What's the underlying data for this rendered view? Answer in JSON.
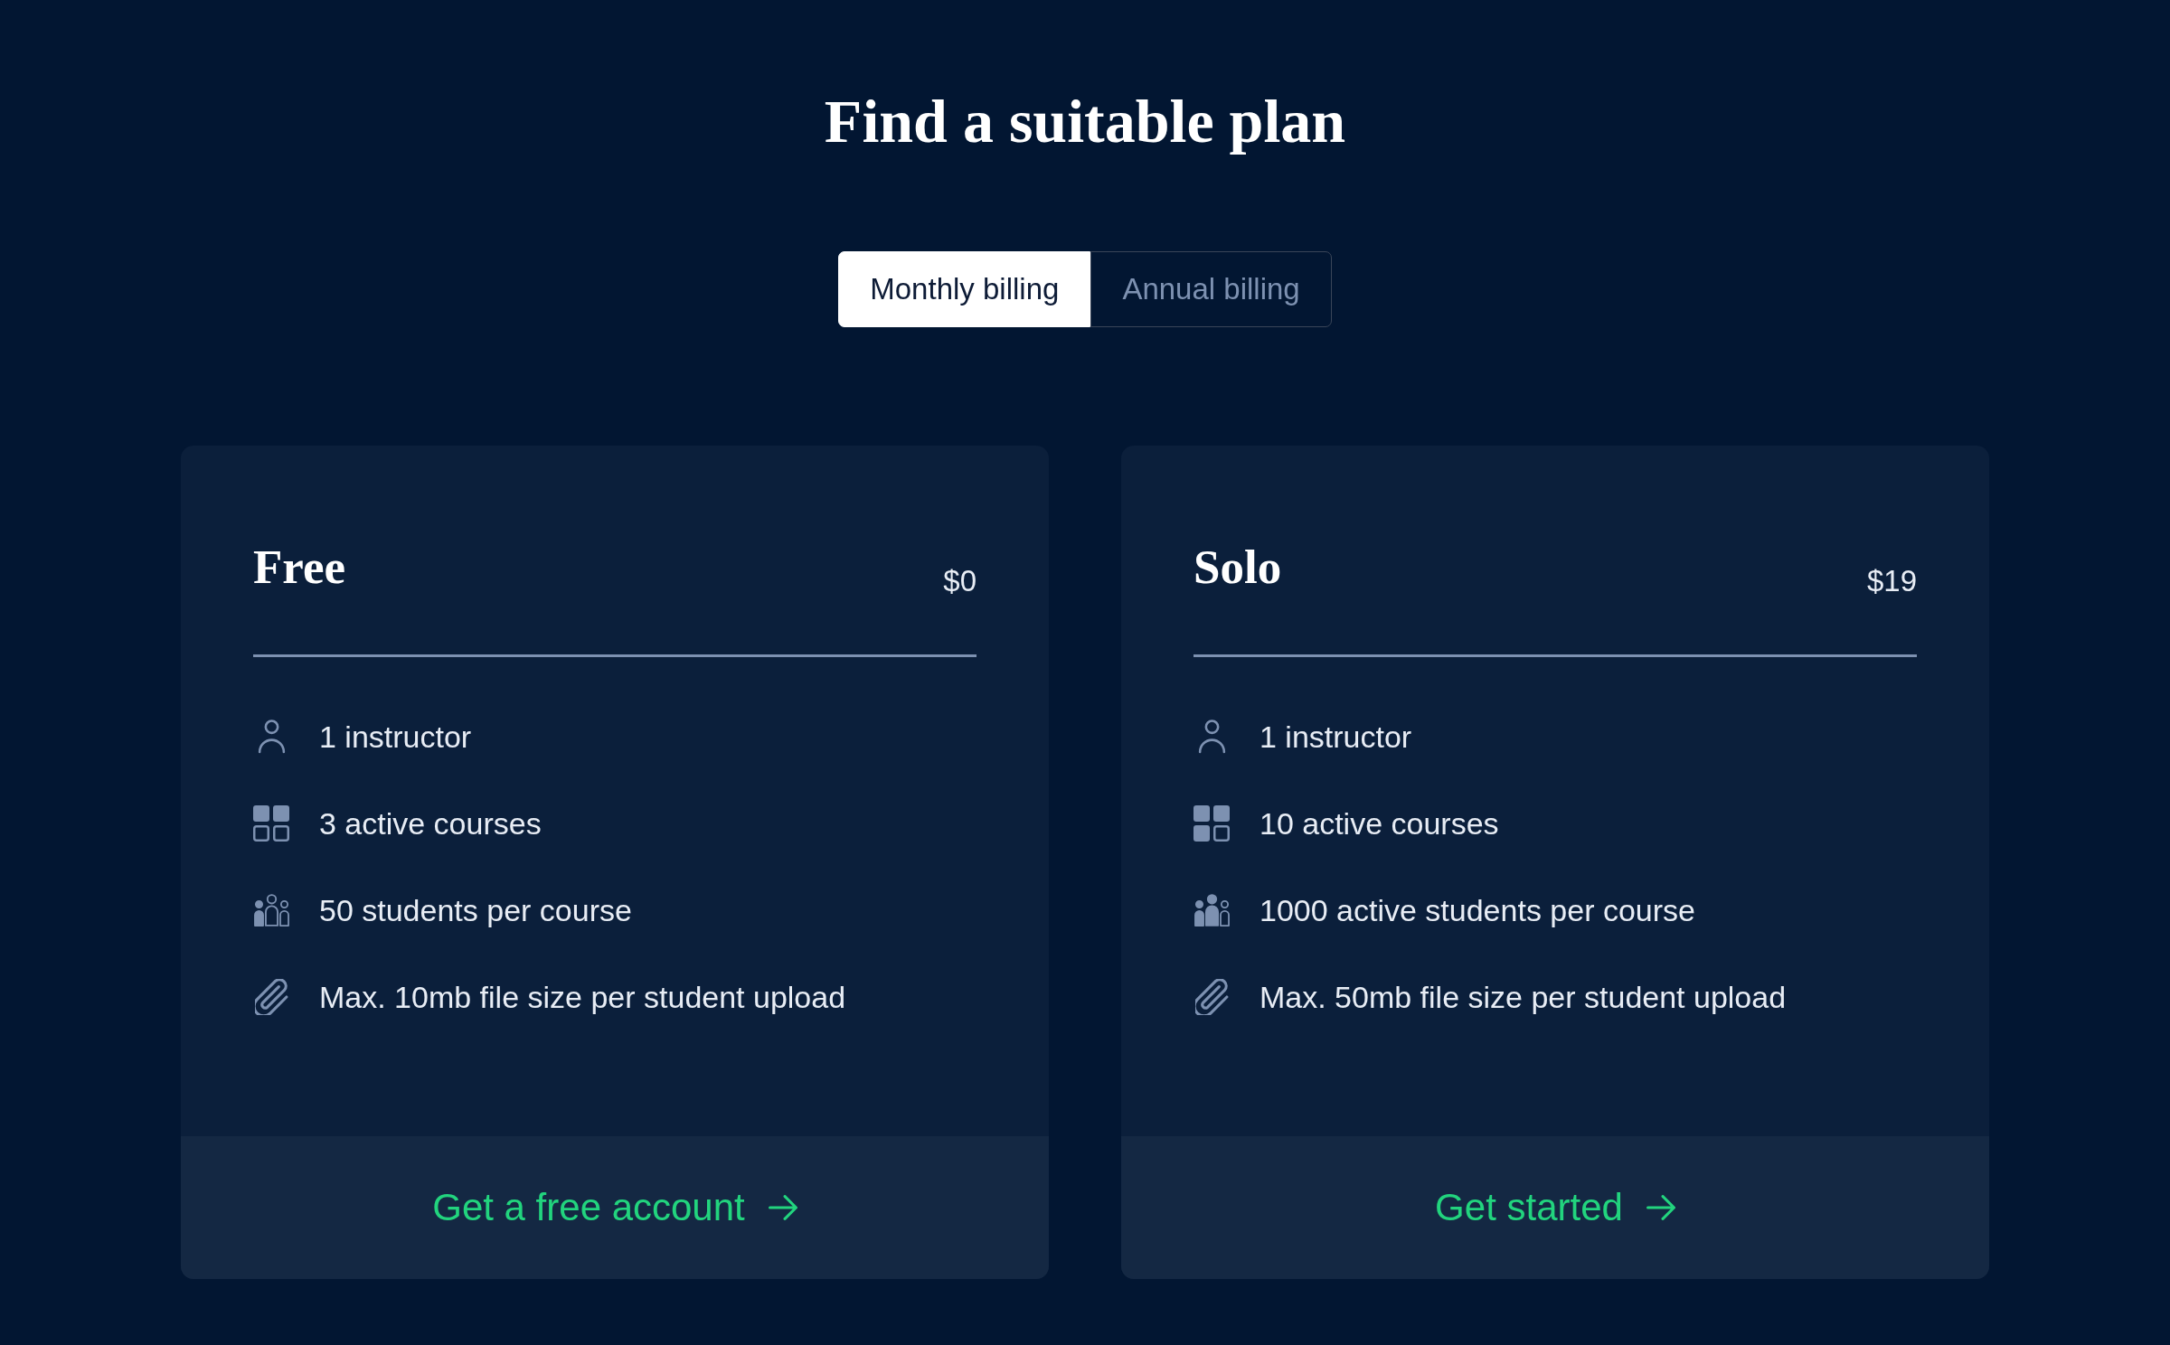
{
  "heading": "Find a suitable plan",
  "billing_toggle": [
    {
      "label": "Monthly billing",
      "selected": true
    },
    {
      "label": "Annual billing",
      "selected": false
    }
  ],
  "plans": [
    {
      "name": "Free",
      "price": "$0",
      "features": [
        {
          "kind": "instructor",
          "text": "1 instructor"
        },
        {
          "kind": "courses",
          "text": "3 active courses",
          "level": 0.5
        },
        {
          "kind": "students",
          "text": "50 students per course",
          "figures": [
            {
              "filled": true
            },
            {
              "filled": false
            },
            {
              "filled": false
            }
          ]
        },
        {
          "kind": "upload",
          "text": "Max. 10mb file size per student upload"
        }
      ],
      "cta": "Get a free account"
    },
    {
      "name": "Solo",
      "price": "$19",
      "features": [
        {
          "kind": "instructor",
          "text": "1 instructor"
        },
        {
          "kind": "courses",
          "text": "10 active courses",
          "level": 0.75
        },
        {
          "kind": "students",
          "text": "1000 active students per course",
          "figures": [
            {
              "filled": true
            },
            {
              "filled": true
            },
            {
              "filled": false
            }
          ]
        },
        {
          "kind": "upload",
          "text": "Max. 50mb file size per student upload"
        }
      ],
      "cta": "Get started"
    }
  ]
}
